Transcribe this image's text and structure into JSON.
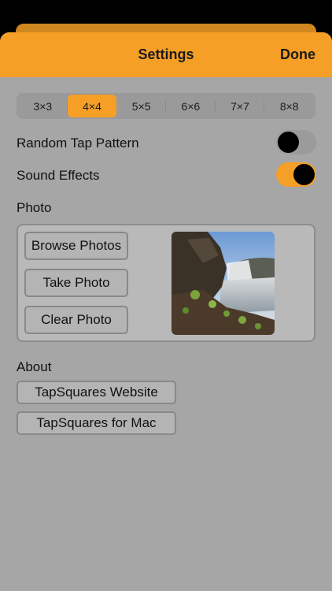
{
  "nav": {
    "title": "Settings",
    "done_label": "Done"
  },
  "grid_sizes": {
    "options": [
      "3×3",
      "4×4",
      "5×5",
      "6×6",
      "7×7",
      "8×8"
    ],
    "selected": "4×4"
  },
  "random_tap": {
    "label": "Random Tap Pattern",
    "on": false
  },
  "sound_effects": {
    "label": "Sound Effects",
    "on": true
  },
  "photo": {
    "heading": "Photo",
    "browse_label": "Browse Photos",
    "take_label": "Take Photo",
    "clear_label": "Clear Photo",
    "preview_icon": "waterfall-photo"
  },
  "about": {
    "heading": "About",
    "website_label": "TapSquares Website",
    "mac_label": "TapSquares for Mac"
  },
  "colors": {
    "accent": "#f59f26",
    "background": "#a6a6a6",
    "knob": "#000000"
  }
}
